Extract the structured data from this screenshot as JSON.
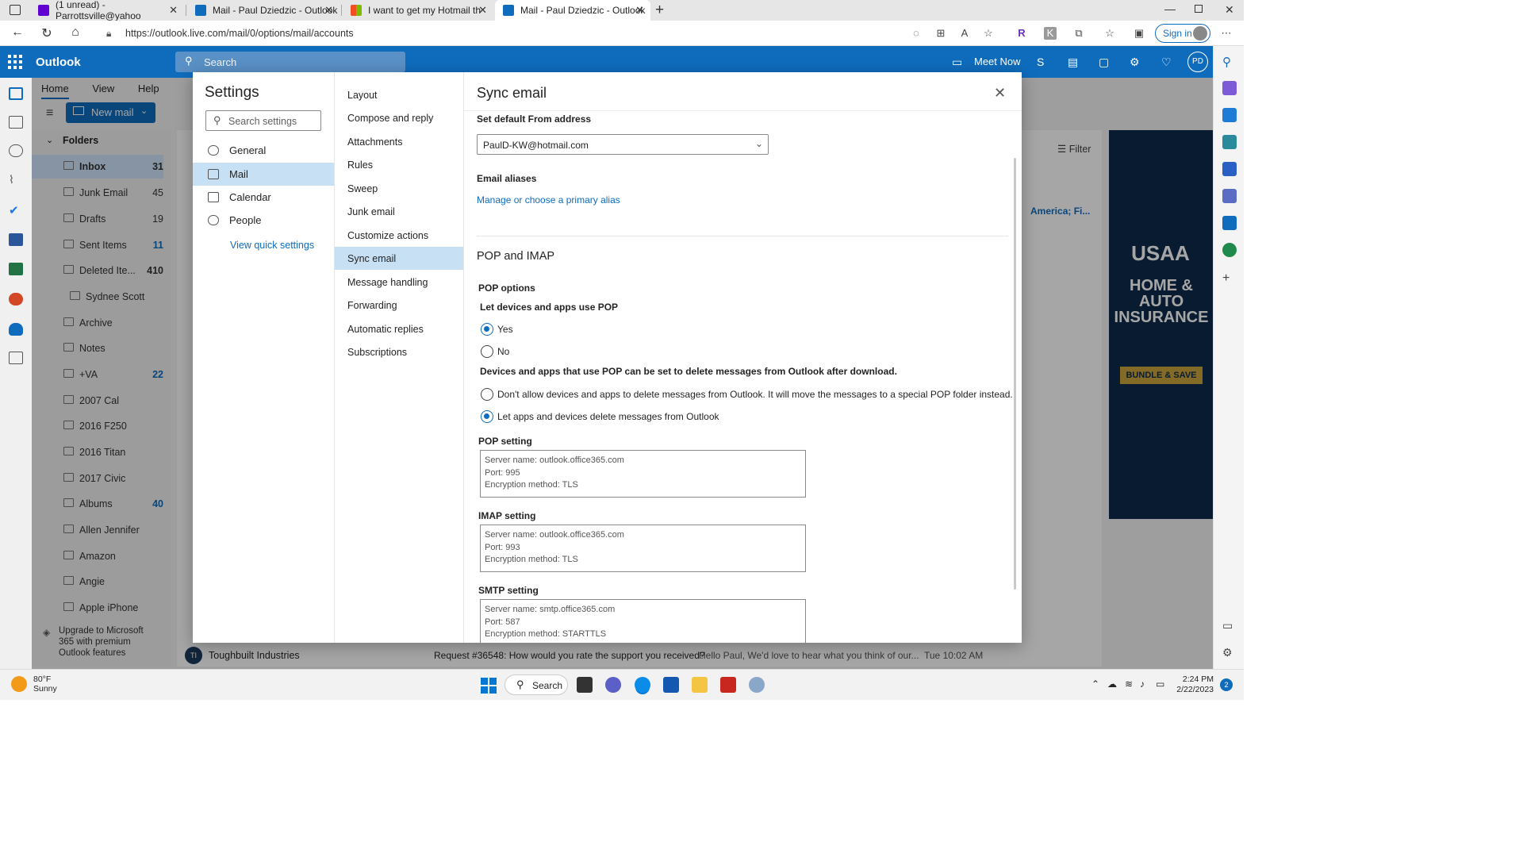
{
  "browser": {
    "tabs": [
      {
        "title": "(1 unread) - Parrottsville@yahoo",
        "color": "#6001d2"
      },
      {
        "title": "Mail - Paul Dziedzic - Outlook",
        "color": "#0f6cbd"
      },
      {
        "title": "I want to get my Hotmail throug",
        "color": "#f25022"
      },
      {
        "title": "Mail - Paul Dziedzic - Outlook",
        "color": "#0f6cbd"
      }
    ],
    "url": "https://outlook.live.com/mail/0/options/mail/accounts",
    "signin": "Sign in"
  },
  "header": {
    "app": "Outlook",
    "search_placeholder": "Search",
    "meet_now": "Meet Now",
    "avatar": "PD"
  },
  "ribbon": {
    "tabs": [
      "Home",
      "View",
      "Help"
    ],
    "new_mail": "New mail"
  },
  "folders": {
    "title": "Folders",
    "items": [
      {
        "name": "Inbox",
        "count": "31"
      },
      {
        "name": "Junk Email",
        "count": "45"
      },
      {
        "name": "Drafts",
        "count": "19"
      },
      {
        "name": "Sent Items",
        "count": "11"
      },
      {
        "name": "Deleted Ite...",
        "count": "410"
      },
      {
        "name": "Sydnee Scott",
        "count": ""
      },
      {
        "name": "Archive",
        "count": ""
      },
      {
        "name": "Notes",
        "count": ""
      },
      {
        "name": "+VA",
        "count": "22"
      },
      {
        "name": "2007 Cal",
        "count": ""
      },
      {
        "name": "2016 F250",
        "count": ""
      },
      {
        "name": "2016 Titan",
        "count": ""
      },
      {
        "name": "2017 Civic",
        "count": ""
      },
      {
        "name": "Albums",
        "count": "40"
      },
      {
        "name": "Allen Jennifer",
        "count": ""
      },
      {
        "name": "Amazon",
        "count": ""
      },
      {
        "name": "Angie",
        "count": ""
      },
      {
        "name": "Apple iPhone",
        "count": ""
      }
    ],
    "upgrade": "Upgrade to Microsoft 365 with premium Outlook features"
  },
  "message_list": {
    "filter": "Filter",
    "peek": "America; Fi...",
    "bottom_sender": "Toughbuilt Industries",
    "bottom_initials": "TI",
    "bottom_subject": "Request #36548: How would you rate the support you received?",
    "bottom_preview": "Hello Paul, We'd love to hear what you think of our...",
    "bottom_time": "Tue 10:02 AM"
  },
  "ad": {
    "brand": "USAA",
    "headline": "HOME & AUTO INSURANCE",
    "cta": "BUNDLE & SAVE"
  },
  "settings": {
    "title": "Settings",
    "search_placeholder": "Search settings",
    "categories": [
      "General",
      "Mail",
      "Calendar",
      "People"
    ],
    "view_quick": "View quick settings",
    "mail_sections": [
      "Layout",
      "Compose and reply",
      "Attachments",
      "Rules",
      "Sweep",
      "Junk email",
      "Customize actions",
      "Sync email",
      "Message handling",
      "Forwarding",
      "Automatic replies",
      "Subscriptions"
    ]
  },
  "sync": {
    "title": "Sync email",
    "default_from_label": "Set default From address",
    "default_from_value": "PaulD-KW@hotmail.com",
    "aliases_label": "Email aliases",
    "aliases_link": "Manage or choose a primary alias",
    "pop_imap_title": "POP and IMAP",
    "pop_options": "POP options",
    "let_pop": "Let devices and apps use POP",
    "yes": "Yes",
    "no": "No",
    "delete_desc": "Devices and apps that use POP can be set to delete messages from Outlook after download.",
    "opt_dont_allow": "Don't allow devices and apps to delete messages from Outlook. It will move the messages to a special POP folder instead.",
    "opt_let": "Let apps and devices delete messages from Outlook",
    "pop_setting": "POP setting",
    "pop_lines": [
      "Server name: outlook.office365.com",
      "Port: 995",
      "Encryption method: TLS"
    ],
    "imap_setting": "IMAP setting",
    "imap_lines": [
      "Server name: outlook.office365.com",
      "Port: 993",
      "Encryption method: TLS"
    ],
    "smtp_setting": "SMTP setting",
    "smtp_lines": [
      "Server name: smtp.office365.com",
      "Port: 587",
      "Encryption method: STARTTLS"
    ]
  },
  "taskbar": {
    "temp": "80°F",
    "weather": "Sunny",
    "search": "Search",
    "time": "2:24 PM",
    "date": "2/22/2023",
    "badge": "2"
  }
}
